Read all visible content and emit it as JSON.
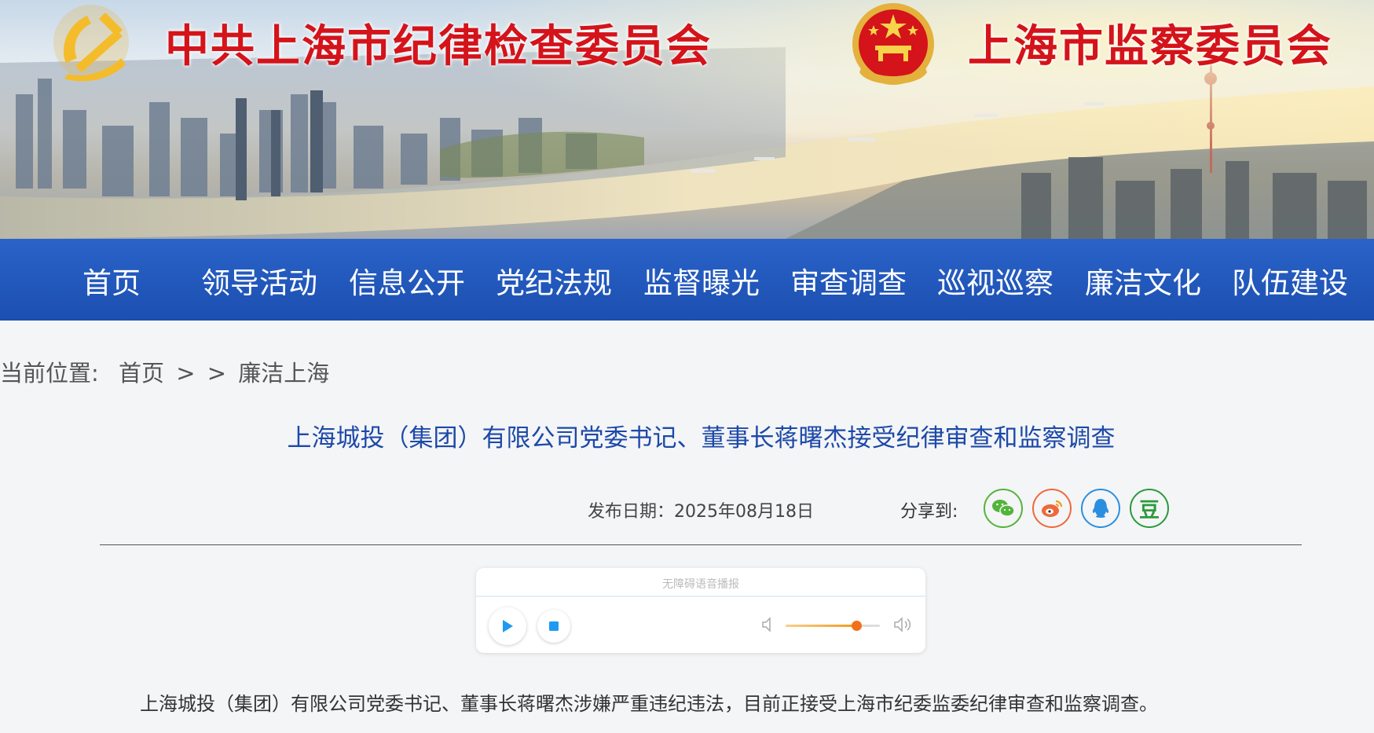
{
  "header": {
    "title_left": "中共上海市纪律检查委员会",
    "title_right": "上海市监察委员会",
    "left_emblem": "party-emblem-icon",
    "right_emblem": "national-emblem-icon"
  },
  "nav": {
    "items": [
      "首页",
      "领导活动",
      "信息公开",
      "党纪法规",
      "监督曝光",
      "审查调查",
      "巡视巡察",
      "廉洁文化",
      "队伍建设"
    ]
  },
  "breadcrumb": {
    "label": "当前位置:",
    "home": "首页",
    "sep1": ">",
    "sep2": ">",
    "current": "廉洁上海"
  },
  "article": {
    "title": "上海城投（集团）有限公司党委书记、董事长蒋曙杰接受纪律审查和监察调查",
    "date": "发布日期：2025年08月18日",
    "share_label": "分享到:",
    "share_buttons": [
      {
        "name": "wechat-icon",
        "color": "#53b43b"
      },
      {
        "name": "weibo-icon",
        "color": "#f0683a"
      },
      {
        "name": "qq-icon",
        "color": "#2b8fe0"
      },
      {
        "name": "douban-icon",
        "color": "#2b9a3b",
        "glyph": "豆"
      }
    ],
    "body": "上海城投（集团）有限公司党委书记、董事长蒋曙杰涉嫌严重违纪违法，目前正接受上海市纪委监委纪律审查和监察调查。"
  },
  "player": {
    "label": "无障碍语音播报",
    "volume": 0.75
  }
}
